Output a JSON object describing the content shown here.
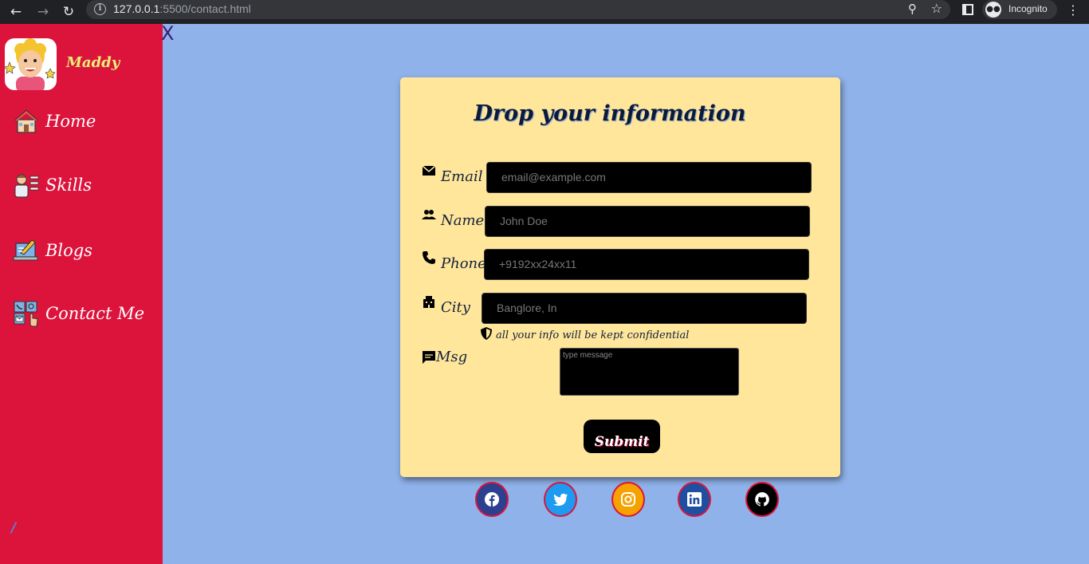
{
  "browser": {
    "url_host": "127.0.0.1",
    "url_path": ":5500/contact.html",
    "profile_label": "Incognito"
  },
  "sidebar": {
    "brand": "Maddy",
    "items": [
      {
        "label": "Home",
        "icon": "house-icon"
      },
      {
        "label": "Skills",
        "icon": "skills-icon"
      },
      {
        "label": "Blogs",
        "icon": "laptop-pen-icon"
      },
      {
        "label": "Contact Me",
        "icon": "contact-card-icon"
      }
    ],
    "footer_mark": "/"
  },
  "close_label": "X",
  "form": {
    "title": "Drop your information",
    "fields": {
      "email": {
        "label": "Email",
        "placeholder": "email@example.com",
        "icon": "mail-icon"
      },
      "name": {
        "label": "Name",
        "placeholder": "John Doe",
        "icon": "people-icon"
      },
      "phone": {
        "label": "Phone",
        "placeholder": "+9192xx24xx11",
        "icon": "phone-icon"
      },
      "city": {
        "label": "City",
        "placeholder": "Banglore, In",
        "icon": "building-icon"
      },
      "msg": {
        "label": "Msg",
        "placeholder": "type message",
        "icon": "chat-icon"
      }
    },
    "note": "all your info will be kept confidential",
    "submit_label": "Submit"
  },
  "social": [
    {
      "name": "facebook",
      "bg": "#2d3f8f"
    },
    {
      "name": "twitter",
      "bg": "#1d9bf0"
    },
    {
      "name": "instagram",
      "bg": "#f5a100"
    },
    {
      "name": "linkedin",
      "bg": "#1f4fa0"
    },
    {
      "name": "github",
      "bg": "#000000"
    }
  ],
  "colors": {
    "page_bg": "#8fb2ea",
    "sidebar_bg": "#dc143c",
    "card_bg": "#ffe69a",
    "brand_text": "#e8f07a"
  }
}
